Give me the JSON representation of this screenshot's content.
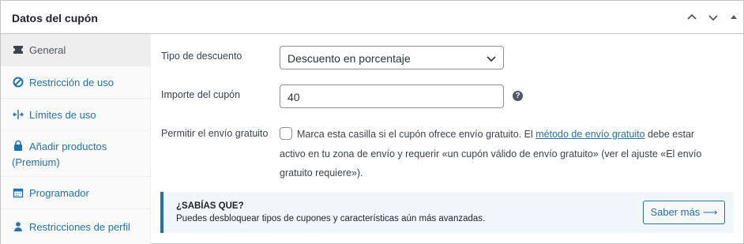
{
  "panel": {
    "title": "Datos del cupón",
    "controls": [
      "chevron-up-icon",
      "chevron-down-icon",
      "triangle-up-icon"
    ]
  },
  "sidebar": {
    "items": [
      {
        "label": "General",
        "icon": "ticket-icon",
        "active": true
      },
      {
        "label": "Restricción de uso",
        "icon": "prohibited-icon"
      },
      {
        "label": "Límites de uso",
        "icon": "arrows-split-icon"
      },
      {
        "label": "Añadir productos",
        "label2": "(Premium)",
        "icon": "bag-icon"
      },
      {
        "label": "Programador",
        "icon": "calendar-icon"
      },
      {
        "label": "Restricciones de perfil",
        "icon": "user-icon"
      }
    ]
  },
  "form": {
    "discount_type_label": "Tipo de descuento",
    "discount_type_value": "Descuento en porcentaje",
    "amount_label": "Importe del cupón",
    "amount_value": "40",
    "free_shipping_label": "Permitir el envío gratuito",
    "free_shipping_text_before": "Marca esta casilla si el cupón ofrece envío gratuito. El ",
    "free_shipping_link": "método de envío gratuito",
    "free_shipping_text_after": " debe estar activo en tu zona de envío y requerir «un cupón válido de envío gratuito» (ver el ajuste «El envío gratuito requiere»).",
    "free_shipping_checked": false
  },
  "notice": {
    "title": "¿SABÍAS QUE?",
    "text": "Puedes desbloquear tipos de cupones y características aún más avanzadas.",
    "button_label": "Saber más ⟶"
  },
  "colors": {
    "accent": "#2271b1",
    "notice_bg": "#f0f6fc"
  }
}
